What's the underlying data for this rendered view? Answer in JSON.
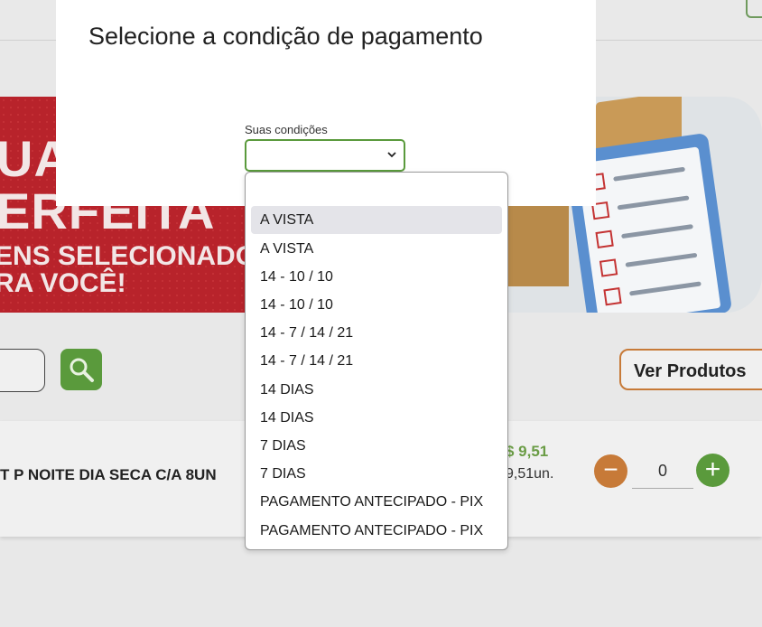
{
  "modal": {
    "title": "Selecione a condição de pagamento",
    "select_label": "Suas condições",
    "select_value": ""
  },
  "dropdown": {
    "options": [
      "",
      "A VISTA",
      "A VISTA",
      "14 - 10 / 10",
      "14 - 10 / 10",
      "14 - 7 / 14 / 21",
      "14 - 7 / 14 / 21",
      "14 DIAS",
      "14 DIAS",
      "7 DIAS",
      "7 DIAS",
      "PAGAMENTO ANTECIPADO - PIX",
      "PAGAMENTO ANTECIPADO - PIX"
    ],
    "highlighted_index": 1
  },
  "banner": {
    "line1": "UA",
    "line2": "ERFEITA",
    "line3": "ENS SELECIONADO",
    "line4": "RA VOCÊ!"
  },
  "search": {
    "icon": "magnifier-icon"
  },
  "catalog": {
    "view_products_label": "Ver Produtos"
  },
  "product": {
    "name": "T P NOITE DIA SECA C/A 8UN",
    "price": "$ 9,51",
    "unit_price": "9,51un.",
    "quantity": "0"
  },
  "colors": {
    "accent_green": "#5a9a3c",
    "accent_orange": "#c77a38",
    "banner_red": "#b8232b"
  }
}
